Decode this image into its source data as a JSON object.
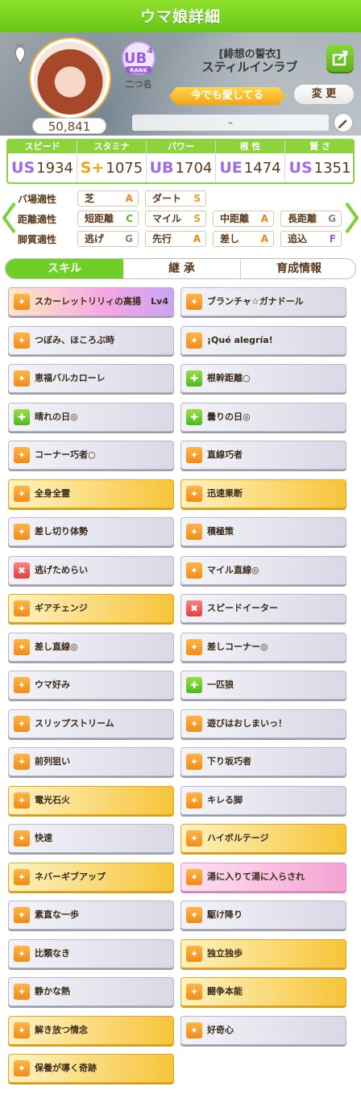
{
  "header": {
    "title": "ウマ娘詳細"
  },
  "profile": {
    "fans": "50,841",
    "rank_label": "RANK",
    "rank_grade": "UB",
    "rank_sub_num": "4",
    "rank_nickname": "二つ名",
    "costume_title": "[緋想の誓衣]",
    "name": "スティルインラブ",
    "motto": "今でも愛してる",
    "change_label": "変 更",
    "comment": "–"
  },
  "stats": [
    {
      "label": "スピード",
      "grade": "US",
      "sub": "3",
      "value": "1934"
    },
    {
      "label": "スタミナ",
      "grade": "S+",
      "sub": "",
      "value": "1075"
    },
    {
      "label": "パワー",
      "grade": "UB",
      "sub": "",
      "value": "1704"
    },
    {
      "label": "根 性",
      "grade": "UE",
      "sub": "7",
      "value": "1474"
    },
    {
      "label": "賢 さ",
      "grade": "US",
      "sub": "5",
      "value": "1351"
    }
  ],
  "aptitude": {
    "rows": [
      "バ場適性",
      "距離適性",
      "脚質適性"
    ],
    "track": [
      {
        "label": "芝",
        "grade": "A"
      },
      {
        "label": "ダート",
        "grade": "S"
      }
    ],
    "distance": [
      {
        "label": "短距離",
        "grade": "C"
      },
      {
        "label": "マイル",
        "grade": "S"
      },
      {
        "label": "中距離",
        "grade": "A"
      },
      {
        "label": "長距離",
        "grade": "G"
      }
    ],
    "style": [
      {
        "label": "逃げ",
        "grade": "G"
      },
      {
        "label": "先行",
        "grade": "A"
      },
      {
        "label": "差し",
        "grade": "A"
      },
      {
        "label": "追込",
        "grade": "F"
      }
    ]
  },
  "tabs": [
    "スキル",
    "継 承",
    "育成情報"
  ],
  "skills": [
    {
      "name": "スカーレットリリィの高揚",
      "level": "Lv4",
      "style": "u",
      "icon": "o"
    },
    {
      "name": "ブランチャ☆ガナドール",
      "level": "",
      "style": "w",
      "icon": "o"
    },
    {
      "name": "つぼみ、ほころぶ時",
      "level": "",
      "style": "w",
      "icon": "o"
    },
    {
      "name": "¡Qué alegría!",
      "level": "",
      "style": "w",
      "icon": "o"
    },
    {
      "name": "恵福バルカローレ",
      "level": "",
      "style": "w",
      "icon": "o"
    },
    {
      "name": "根幹距離○",
      "level": "",
      "style": "w",
      "icon": "g"
    },
    {
      "name": "晴れの日◎",
      "level": "",
      "style": "w",
      "icon": "g"
    },
    {
      "name": "曇りの日◎",
      "level": "",
      "style": "w",
      "icon": "g"
    },
    {
      "name": "コーナー巧者○",
      "level": "",
      "style": "w",
      "icon": "o"
    },
    {
      "name": "直線巧者",
      "level": "",
      "style": "w",
      "icon": "o"
    },
    {
      "name": "全身全霊",
      "level": "",
      "style": "g",
      "icon": "o"
    },
    {
      "name": "迅速果断",
      "level": "",
      "style": "g",
      "icon": "o"
    },
    {
      "name": "差し切り体勢",
      "level": "",
      "style": "w",
      "icon": "o"
    },
    {
      "name": "積極策",
      "level": "",
      "style": "w",
      "icon": "o"
    },
    {
      "name": "逃げためらい",
      "level": "",
      "style": "w",
      "icon": "r"
    },
    {
      "name": "マイル直線◎",
      "level": "",
      "style": "w",
      "icon": "o"
    },
    {
      "name": "ギアチェンジ",
      "level": "",
      "style": "g",
      "icon": "o"
    },
    {
      "name": "スピードイーター",
      "level": "",
      "style": "w",
      "icon": "r"
    },
    {
      "name": "差し直線◎",
      "level": "",
      "style": "w",
      "icon": "o"
    },
    {
      "name": "差しコーナー◎",
      "level": "",
      "style": "w",
      "icon": "o"
    },
    {
      "name": "ウマ好み",
      "level": "",
      "style": "w",
      "icon": "o"
    },
    {
      "name": "一匹狼",
      "level": "",
      "style": "w",
      "icon": "g"
    },
    {
      "name": "スリップストリーム",
      "level": "",
      "style": "w",
      "icon": "o"
    },
    {
      "name": "遊びはおしまいっ！",
      "level": "",
      "style": "w",
      "icon": "o"
    },
    {
      "name": "前列狙い",
      "level": "",
      "style": "w",
      "icon": "o"
    },
    {
      "name": "下り坂巧者",
      "level": "",
      "style": "w",
      "icon": "o"
    },
    {
      "name": "電光石火",
      "level": "",
      "style": "g",
      "icon": "o"
    },
    {
      "name": "キレる脚",
      "level": "",
      "style": "w",
      "icon": "o"
    },
    {
      "name": "快速",
      "level": "",
      "style": "w",
      "icon": "o"
    },
    {
      "name": "ハイボルテージ",
      "level": "",
      "style": "g",
      "icon": "o"
    },
    {
      "name": "ネバーギブアップ",
      "level": "",
      "style": "g",
      "icon": "o"
    },
    {
      "name": "湯に入りて湯に入らされ",
      "level": "",
      "style": "p",
      "icon": "o"
    },
    {
      "name": "素直な一歩",
      "level": "",
      "style": "w",
      "icon": "o"
    },
    {
      "name": "駆け降り",
      "level": "",
      "style": "w",
      "icon": "o"
    },
    {
      "name": "比類なき",
      "level": "",
      "style": "w",
      "icon": "o"
    },
    {
      "name": "独立独歩",
      "level": "",
      "style": "g",
      "icon": "o"
    },
    {
      "name": "静かな熱",
      "level": "",
      "style": "w",
      "icon": "o"
    },
    {
      "name": "闘争本能",
      "level": "",
      "style": "g",
      "icon": "o"
    },
    {
      "name": "解き放つ情念",
      "level": "",
      "style": "g",
      "icon": "o"
    },
    {
      "name": "好奇心",
      "level": "",
      "style": "w",
      "icon": "o"
    },
    {
      "name": "保養が導く奇跡",
      "level": "",
      "style": "g",
      "icon": "o"
    }
  ],
  "colors": {
    "accent": "#6ed026",
    "gold": "#f6c43a",
    "pink": "#f4a3d3"
  }
}
